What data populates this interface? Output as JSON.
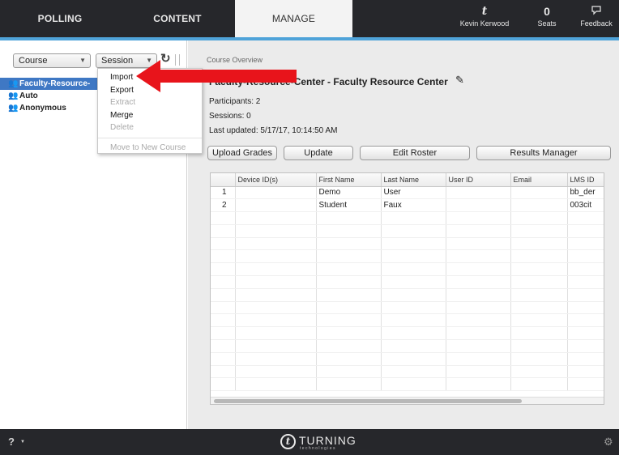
{
  "nav": {
    "tabs": [
      {
        "label": "POLLING"
      },
      {
        "label": "CONTENT"
      },
      {
        "label": "MANAGE"
      }
    ],
    "user": {
      "name": "Kevin Kerwood",
      "icon": "turning-user-icon"
    },
    "seats": {
      "count": "0",
      "label": "Seats"
    },
    "feedback": {
      "label": "Feedback",
      "icon": "feedback-icon"
    }
  },
  "left": {
    "course_select": "Course",
    "session_select": "Session",
    "tree": [
      {
        "label": "Faculty-Resource-",
        "selected": true
      },
      {
        "label": "Auto",
        "selected": false
      },
      {
        "label": "Anonymous",
        "selected": false
      }
    ]
  },
  "session_menu": {
    "items": [
      {
        "label": "Import",
        "enabled": true
      },
      {
        "label": "Export",
        "enabled": true
      },
      {
        "label": "Extract",
        "enabled": false
      },
      {
        "label": "Merge",
        "enabled": true
      },
      {
        "label": "Delete",
        "enabled": false
      }
    ],
    "footer_item": {
      "label": "Move to New Course",
      "enabled": false
    }
  },
  "main": {
    "overview_label": "Course Overview",
    "course_title": "Faculty-Resource-Center - Faculty Resource Center",
    "participants": "Participants: 2",
    "sessions": "Sessions: 0",
    "last_updated": "Last updated: 5/17/17, 10:14:50 AM",
    "buttons": {
      "upload_grades": "Upload Grades",
      "update": "Update",
      "edit_roster": "Edit Roster",
      "results_manager": "Results Manager"
    },
    "table": {
      "headers": [
        "",
        "Device ID(s)",
        "First Name",
        "Last Name",
        "User ID",
        "Email",
        "LMS ID"
      ],
      "rows": [
        [
          "1",
          "",
          "Demo",
          "User",
          "",
          "",
          "bb_der"
        ],
        [
          "2",
          "",
          "Student",
          "Faux",
          "",
          "",
          "003cit"
        ]
      ]
    }
  },
  "footer": {
    "logo_word": "TURNING",
    "logo_sub": "technologies"
  },
  "colors": {
    "accent": "#4fa3d9",
    "selection": "#3f78c4",
    "annotation_arrow": "#e8141b"
  }
}
